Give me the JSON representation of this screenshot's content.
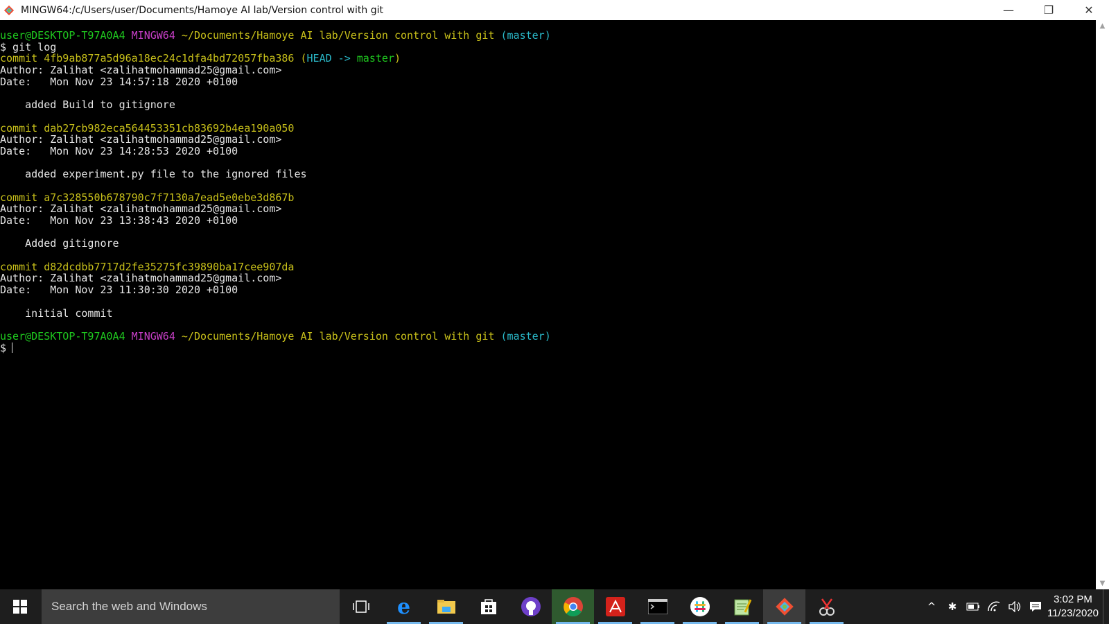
{
  "window": {
    "title": "MINGW64:/c/Users/user/Documents/Hamoye AI lab/Version control with git",
    "controls": {
      "minimize": "—",
      "maximize": "❐",
      "close": "✕"
    }
  },
  "terminal": {
    "lines": [
      [
        {
          "t": "user@DESKTOP-T97A0A4 ",
          "c": "green"
        },
        {
          "t": "MINGW64 ",
          "c": "magenta"
        },
        {
          "t": "~/Documents/Hamoye AI lab/Version control with git ",
          "c": "yellow"
        },
        {
          "t": "(master)",
          "c": "cyan"
        }
      ],
      [
        {
          "t": "$ git log",
          "c": "white"
        }
      ],
      [
        {
          "t": "commit 4fb9ab877a5d96a18ec24c1dfa4bd72057fba386 ",
          "c": "yellow"
        },
        {
          "t": "(",
          "c": "yellow"
        },
        {
          "t": "HEAD -> ",
          "c": "cyan"
        },
        {
          "t": "master",
          "c": "green"
        },
        {
          "t": ")",
          "c": "yellow"
        }
      ],
      [
        {
          "t": "Author: Zalihat <zalihatmohammad25@gmail.com>",
          "c": "white"
        }
      ],
      [
        {
          "t": "Date:   Mon Nov 23 14:57:18 2020 +0100",
          "c": "white"
        }
      ],
      [
        {
          "t": "",
          "c": "white"
        }
      ],
      [
        {
          "t": "    added Build to gitignore",
          "c": "white"
        }
      ],
      [
        {
          "t": "",
          "c": "white"
        }
      ],
      [
        {
          "t": "commit dab27cb982eca564453351cb83692b4ea190a050",
          "c": "yellow"
        }
      ],
      [
        {
          "t": "Author: Zalihat <zalihatmohammad25@gmail.com>",
          "c": "white"
        }
      ],
      [
        {
          "t": "Date:   Mon Nov 23 14:28:53 2020 +0100",
          "c": "white"
        }
      ],
      [
        {
          "t": "",
          "c": "white"
        }
      ],
      [
        {
          "t": "    added experiment.py file to the ignored files",
          "c": "white"
        }
      ],
      [
        {
          "t": "",
          "c": "white"
        }
      ],
      [
        {
          "t": "commit a7c328550b678790c7f7130a7ead5e0ebe3d867b",
          "c": "yellow"
        }
      ],
      [
        {
          "t": "Author: Zalihat <zalihatmohammad25@gmail.com>",
          "c": "white"
        }
      ],
      [
        {
          "t": "Date:   Mon Nov 23 13:38:43 2020 +0100",
          "c": "white"
        }
      ],
      [
        {
          "t": "",
          "c": "white"
        }
      ],
      [
        {
          "t": "    Added gitignore",
          "c": "white"
        }
      ],
      [
        {
          "t": "",
          "c": "white"
        }
      ],
      [
        {
          "t": "commit d82dcdbb7717d2fe35275fc39890ba17cee907da",
          "c": "yellow"
        }
      ],
      [
        {
          "t": "Author: Zalihat <zalihatmohammad25@gmail.com>",
          "c": "white"
        }
      ],
      [
        {
          "t": "Date:   Mon Nov 23 11:30:30 2020 +0100",
          "c": "white"
        }
      ],
      [
        {
          "t": "",
          "c": "white"
        }
      ],
      [
        {
          "t": "    initial commit",
          "c": "white"
        }
      ],
      [
        {
          "t": "",
          "c": "white"
        }
      ],
      [
        {
          "t": "user@DESKTOP-T97A0A4 ",
          "c": "green"
        },
        {
          "t": "MINGW64 ",
          "c": "magenta"
        },
        {
          "t": "~/Documents/Hamoye AI lab/Version control with git ",
          "c": "yellow"
        },
        {
          "t": "(master)",
          "c": "cyan"
        }
      ],
      [
        {
          "t": "$",
          "c": "white",
          "cursor": true
        }
      ]
    ]
  },
  "taskbar": {
    "search_placeholder": "Search the web and Windows",
    "apps": [
      {
        "name": "task-view-icon"
      },
      {
        "name": "edge-icon"
      },
      {
        "name": "file-explorer-icon"
      },
      {
        "name": "store-icon"
      },
      {
        "name": "github-icon"
      },
      {
        "name": "chrome-icon"
      },
      {
        "name": "acrobat-icon"
      },
      {
        "name": "command-prompt-icon"
      },
      {
        "name": "slack-icon"
      },
      {
        "name": "notepad-icon"
      },
      {
        "name": "git-bash-icon"
      },
      {
        "name": "snipping-tool-icon"
      }
    ],
    "clock": {
      "time": "3:02 PM",
      "date": "11/23/2020"
    }
  },
  "colors": {
    "green": "#1fca1f",
    "magenta": "#c83fc8",
    "yellow": "#c8c01a",
    "cyan": "#2ab8c8",
    "white": "#e6e6e6"
  }
}
